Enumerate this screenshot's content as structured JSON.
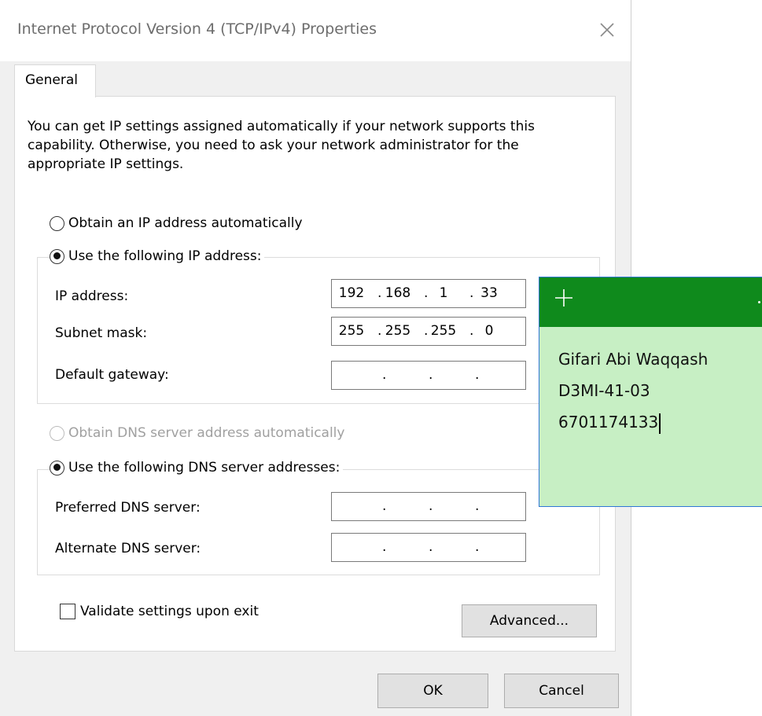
{
  "window": {
    "title": "Internet Protocol Version 4 (TCP/IPv4) Properties",
    "close_icon": "close-icon"
  },
  "tabs": [
    {
      "label": "General",
      "selected": true
    }
  ],
  "intro_text": "You can get IP settings assigned automatically if your network supports this capability. Otherwise, you need to ask your network administrator for the appropriate IP settings.",
  "ip_section": {
    "auto_option": {
      "label": "Obtain an IP address automatically",
      "selected": false
    },
    "manual_option": {
      "label": "Use the following IP address:",
      "selected": true
    },
    "fields": [
      {
        "label": "IP address:",
        "octets": [
          "192",
          "168",
          "1",
          "33"
        ]
      },
      {
        "label": "Subnet mask:",
        "octets": [
          "255",
          "255",
          "255",
          "0"
        ]
      },
      {
        "label": "Default gateway:",
        "octets": [
          "",
          "",
          "",
          ""
        ]
      }
    ]
  },
  "dns_section": {
    "auto_option": {
      "label": "Obtain DNS server address automatically",
      "selected": false,
      "disabled": true
    },
    "manual_option": {
      "label": "Use the following DNS server addresses:",
      "selected": true
    },
    "fields": [
      {
        "label": "Preferred DNS server:",
        "octets": [
          "",
          "",
          "",
          ""
        ]
      },
      {
        "label": "Alternate DNS server:",
        "octets": [
          "",
          "",
          "",
          ""
        ]
      }
    ]
  },
  "validate_checkbox": {
    "label": "Validate settings upon exit",
    "checked": false
  },
  "buttons": {
    "advanced": "Advanced...",
    "ok": "OK",
    "cancel": "Cancel"
  },
  "sticky_note": {
    "header_color": "#0f8a1c",
    "body_color": "#c7efc4",
    "add_icon": "plus-icon",
    "lines": [
      "Gifari Abi Waqqash",
      "D3MI-41-03",
      "6701174133"
    ]
  }
}
